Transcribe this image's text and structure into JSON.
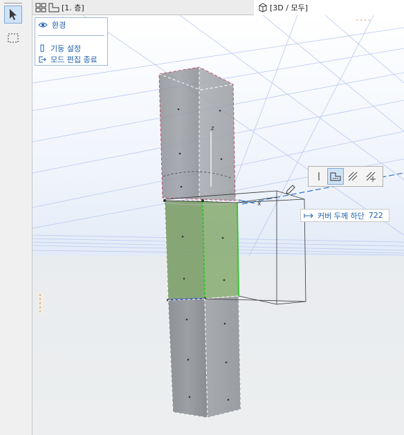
{
  "tabs": {
    "plan_label": "[1. 층]",
    "view3d_label": "[3D / 모두]"
  },
  "env_panel": {
    "environment": "환경",
    "column_settings": "기둥 설정",
    "exit_edit_mode": "모드 편집 종료"
  },
  "tracker": {
    "label": "커버 두께 하단",
    "value": "722"
  },
  "axes": {
    "z": "z",
    "x": "x"
  },
  "corner_mark": "----",
  "colors": {
    "accent_blue": "#1f5faa",
    "selection_green": "#8fc27a",
    "highlight_line": "#1a3ecb",
    "dashed_outline": "#c0506a"
  },
  "icons": {
    "arrow_tool": "arrow-icon",
    "marquee_tool": "marquee-icon",
    "env": "eye-icon",
    "column": "column-icon",
    "exit": "exit-icon",
    "pencil": "pencil-icon"
  }
}
